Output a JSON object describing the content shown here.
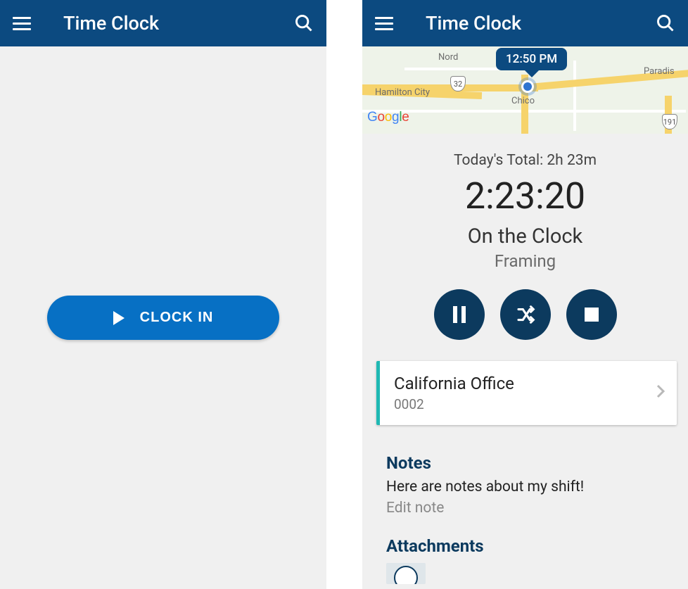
{
  "left": {
    "title": "Time Clock",
    "clock_in_label": "CLOCK IN"
  },
  "right": {
    "title": "Time Clock",
    "map": {
      "pin_time": "12:50 PM",
      "places": {
        "nord": "Nord",
        "hamilton": "Hamilton City",
        "chico": "Chico",
        "paradise": "Paradis",
        "hwy32": "32",
        "hwy191": "191"
      },
      "logo": {
        "g": "G",
        "o1": "o",
        "o2": "o",
        "g2": "g",
        "l": "l",
        "e": "e"
      }
    },
    "today_total_label": "Today's Total: 2h 23m",
    "timer": "2:23:20",
    "status": "On the Clock",
    "task": "Framing",
    "location": {
      "name": "California Office",
      "code": "0002"
    },
    "notes": {
      "header": "Notes",
      "body": "Here are notes about my shift!",
      "edit": "Edit note"
    },
    "attachments_header": "Attachments"
  }
}
